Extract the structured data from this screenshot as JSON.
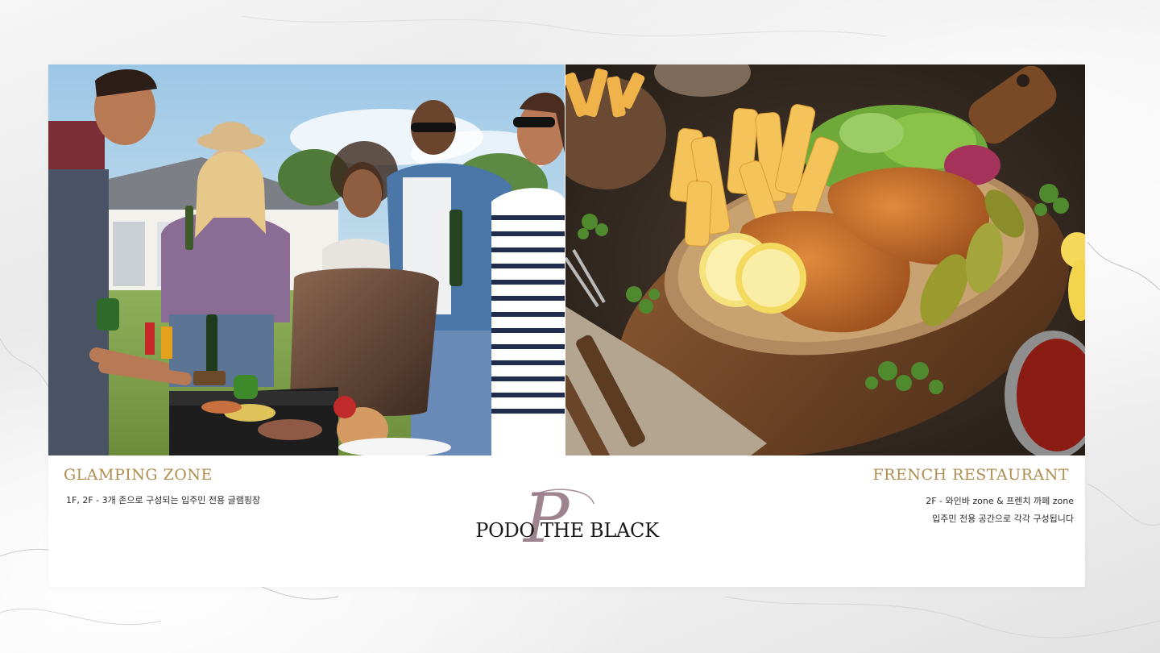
{
  "glamping": {
    "title": "GLAMPING ZONE",
    "description": "1F, 2F - 3개 존으로 구성되는 입주민 전용 글램핑장"
  },
  "restaurant": {
    "title": "FRENCH RESTAURANT",
    "description_line1": "2F - 와인바 zone & 프렌치 까페 zone",
    "description_line2": "입주민 전용 공간으로 각각 구성됩니다"
  },
  "brand": {
    "name": "PODO THE BLACK",
    "monogram": "P"
  },
  "colors": {
    "accent_gold": "#b08d4f",
    "monogram_mauve": "#8c6f7c",
    "text_dark": "#1a1a1a"
  }
}
